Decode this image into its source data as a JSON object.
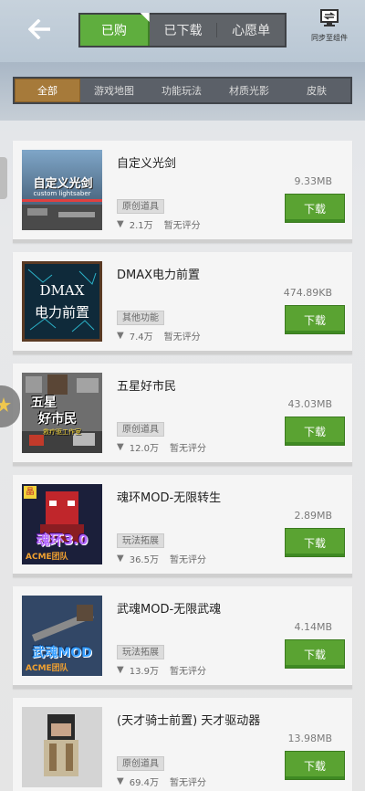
{
  "header": {
    "tabs": [
      {
        "label": "已购",
        "active": true
      },
      {
        "label": "已下载",
        "active": false
      },
      {
        "label": "心愿单",
        "active": false
      }
    ],
    "sync_label": "同步至组件"
  },
  "filters": [
    "全部",
    "游戏地图",
    "功能玩法",
    "材质光影",
    "皮肤"
  ],
  "items": [
    {
      "title": "自定义光剑",
      "size": "9.33MB",
      "tag": "原创道具",
      "downloads": "2.1万",
      "rating": "暂无评分",
      "button": "下载",
      "thumb_text": [
        "自定义光剑",
        "custom lightsaber"
      ],
      "thumb_bg": "#3a4d63"
    },
    {
      "title": "DMAX电力前置",
      "size": "474.89KB",
      "tag": "其他功能",
      "downloads": "7.4万",
      "rating": "暂无评分",
      "button": "下载",
      "thumb_text": [
        "DMAX",
        "电力前置"
      ],
      "thumb_bg": "#0f2a3a"
    },
    {
      "title": "五星好市民",
      "size": "43.03MB",
      "tag": "原创道具",
      "downloads": "12.0万",
      "rating": "暂无评分",
      "button": "下载",
      "thumb_text": [
        "五星",
        "好市民",
        "救疗驱工作室"
      ],
      "thumb_bg": "#6d6d6d"
    },
    {
      "title": "魂环MOD-无限转生",
      "size": "2.89MB",
      "tag": "玩法拓展",
      "downloads": "36.5万",
      "rating": "暂无评分",
      "button": "下载",
      "thumb_text": [
        "魂环3.0",
        "ACME团队",
        "晶"
      ],
      "thumb_bg": "#1b1b2a"
    },
    {
      "title": "武魂MOD-无限武魂",
      "size": "4.14MB",
      "tag": "玩法拓展",
      "downloads": "13.9万",
      "rating": "暂无评分",
      "button": "下载",
      "thumb_text": [
        "武魂MOD",
        "ACME团队"
      ],
      "thumb_bg": "#2d3b52"
    },
    {
      "title": "(天才骑士前置) 天才驱动器",
      "size": "13.98MB",
      "tag": "原创道具",
      "downloads": "69.4万",
      "rating": "暂无评分",
      "button": "下载",
      "thumb_text": [],
      "thumb_bg": "#c9c9c9"
    }
  ]
}
